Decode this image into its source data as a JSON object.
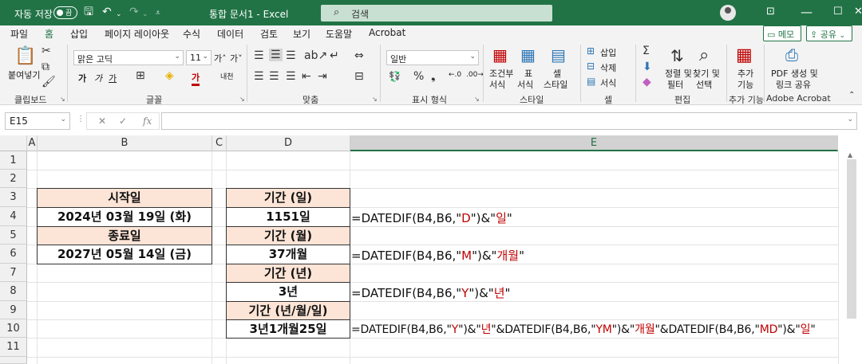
{
  "titlebar": {
    "autosave": "자동 저장",
    "toggle": "끔",
    "doc_title": "통합 문서1  -  Excel",
    "search_placeholder": "검색"
  },
  "menu": {
    "tabs": [
      "파일",
      "홈",
      "삽입",
      "페이지 레이아웃",
      "수식",
      "데이터",
      "검토",
      "보기",
      "도움말",
      "Acrobat"
    ],
    "active_tab": "홈",
    "memo": "메모",
    "share": "공유"
  },
  "ribbon": {
    "clipboard": {
      "paste": "붙여넣기",
      "label": "클립보드"
    },
    "font": {
      "name": "맑은 고딕",
      "size": "11",
      "label": "글꼴"
    },
    "align": {
      "label": "맞춤"
    },
    "number": {
      "format": "일반",
      "label": "표시 형식"
    },
    "style": {
      "cond1": "조건부",
      "cond2": "서식",
      "table1": "표",
      "table2": "서식",
      "cell1": "셀",
      "cell2": "스타일",
      "label": "스타일"
    },
    "cells": {
      "insert": "삽입",
      "delete": "삭제",
      "format": "서식",
      "label": "셀"
    },
    "editing": {
      "sort1": "정렬 및",
      "sort2": "필터",
      "find1": "찾기 및",
      "find2": "선택",
      "label": "편집"
    },
    "addins": {
      "l1": "추가",
      "l2": "기능",
      "label": "추가 기능"
    },
    "adobe": {
      "l1": "PDF 생성 및",
      "l2": "링크 공유",
      "label": "Adobe Acrobat"
    }
  },
  "formula_bar": {
    "name_box": "E15",
    "fx": "fx",
    "value": ""
  },
  "columns": [
    "A",
    "B",
    "C",
    "D",
    "E"
  ],
  "selected_column": "E",
  "rows": [
    "1",
    "2",
    "3",
    "4",
    "5",
    "6",
    "7",
    "8",
    "9",
    "10",
    "11"
  ],
  "cells": {
    "B3": "시작일",
    "B4": "2024년 03월 19일 (화)",
    "B5": "종료일",
    "B6": "2027년 05월 14일 (금)",
    "D3": "기간 (일)",
    "D4": "1151일",
    "D5": "기간 (월)",
    "D6": "37개월",
    "D7": "기간 (년)",
    "D8": "3년",
    "D9": "기간 (년/월/일)",
    "D10": "3년1개월25일"
  },
  "formulas": {
    "E4": {
      "p1": "=DATEDIF(B4,B6,\"",
      "s1": "D",
      "p2": "\")&\"",
      "s2": "일",
      "p3": "\""
    },
    "E6": {
      "p1": "=DATEDIF(B4,B6,\"",
      "s1": "M",
      "p2": "\")&\"",
      "s2": "개월",
      "p3": "\""
    },
    "E8": {
      "p1": "=DATEDIF(B4,B6,\"",
      "s1": "Y",
      "p2": "\")&\"",
      "s2": "년",
      "p3": "\""
    },
    "E10": {
      "p1": "=DATEDIF(B4,B6,\"",
      "s1": "Y",
      "p2": "\")&\"",
      "s2": "년",
      "p3": "\"&DATEDIF(B4,B6,\"",
      "s3": "YM",
      "p4": "\")&\"",
      "s4": "개월",
      "p5": "\"&DATEDIF(B4,B6,\"",
      "s5": "MD",
      "p6": "\")&\"",
      "s6": "일",
      "p7": "\""
    }
  },
  "colors": {
    "excel_green": "#217346",
    "header_fill": "#fce4d6",
    "string_red": "#c00000"
  }
}
